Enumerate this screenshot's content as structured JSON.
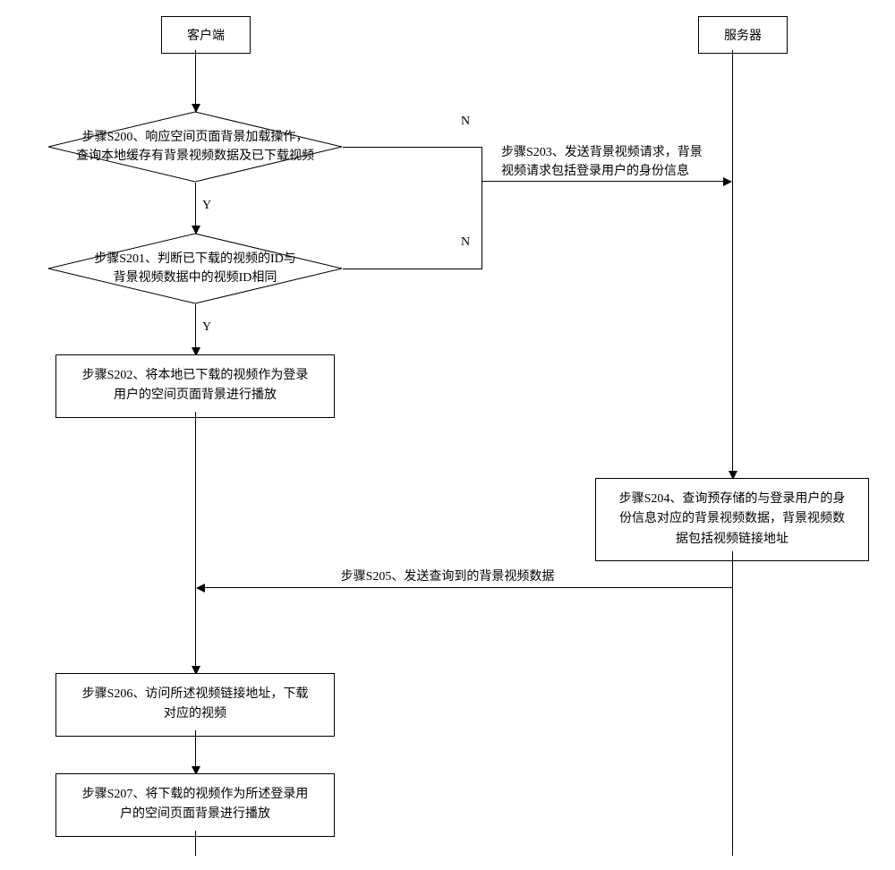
{
  "lanes": {
    "client": "客户端",
    "server": "服务器"
  },
  "s200": "步骤S200、响应空间页面背景加载操作，\n查询本地缓存有背景视频数据及已下载视频",
  "s201": "步骤S201、判断已下载的视频的ID与\n背景视频数据中的视频ID相同",
  "s202": "步骤S202、将本地已下载的视频作为登录\n用户的空间页面背景进行播放",
  "s203": "步骤S203、发送背景视频请求，背景\n视频请求包括登录用户的身份信息",
  "s204": "步骤S204、查询预存储的与登录用户的身\n份信息对应的背景视频数据，背景视频数\n据包括视频链接地址",
  "s205": "步骤S205、发送查询到的背景视频数据",
  "s206": "步骤S206、访问所述视频链接地址，下载\n对应的视频",
  "s207": "步骤S207、将下载的视频作为所述登录用\n户的空间页面背景进行播放",
  "labels": {
    "y": "Y",
    "n": "N"
  },
  "chart_data": {
    "type": "flowchart-swimlane",
    "lanes": [
      "客户端",
      "服务器"
    ],
    "nodes": [
      {
        "id": "S200",
        "lane": "客户端",
        "type": "decision",
        "text": "步骤S200、响应空间页面背景加载操作，查询本地缓存有背景视频数据及已下载视频"
      },
      {
        "id": "S201",
        "lane": "客户端",
        "type": "decision",
        "text": "步骤S201、判断已下载的视频的ID与背景视频数据中的视频ID相同"
      },
      {
        "id": "S202",
        "lane": "客户端",
        "type": "process",
        "text": "步骤S202、将本地已下载的视频作为登录用户的空间页面背景进行播放"
      },
      {
        "id": "S203",
        "lane": "msg-client-to-server",
        "type": "message",
        "text": "步骤S203、发送背景视频请求，背景视频请求包括登录用户的身份信息"
      },
      {
        "id": "S204",
        "lane": "服务器",
        "type": "process",
        "text": "步骤S204、查询预存储的与登录用户的身份信息对应的背景视频数据，背景视频数据包括视频链接地址"
      },
      {
        "id": "S205",
        "lane": "msg-server-to-client",
        "type": "message",
        "text": "步骤S205、发送查询到的背景视频数据"
      },
      {
        "id": "S206",
        "lane": "客户端",
        "type": "process",
        "text": "步骤S206、访问所述视频链接地址，下载对应的视频"
      },
      {
        "id": "S207",
        "lane": "客户端",
        "type": "process",
        "text": "步骤S207、将下载的视频作为所述登录用户的空间页面背景进行播放"
      }
    ],
    "edges": [
      {
        "from": "client-lane",
        "to": "S200"
      },
      {
        "from": "S200",
        "to": "S201",
        "label": "Y"
      },
      {
        "from": "S200",
        "to": "S203",
        "label": "N"
      },
      {
        "from": "S201",
        "to": "S202",
        "label": "Y"
      },
      {
        "from": "S201",
        "to": "S203",
        "label": "N"
      },
      {
        "from": "S203",
        "to": "S204"
      },
      {
        "from": "S204",
        "to": "S205"
      },
      {
        "from": "S205",
        "to": "S206"
      },
      {
        "from": "S206",
        "to": "S207"
      }
    ]
  }
}
